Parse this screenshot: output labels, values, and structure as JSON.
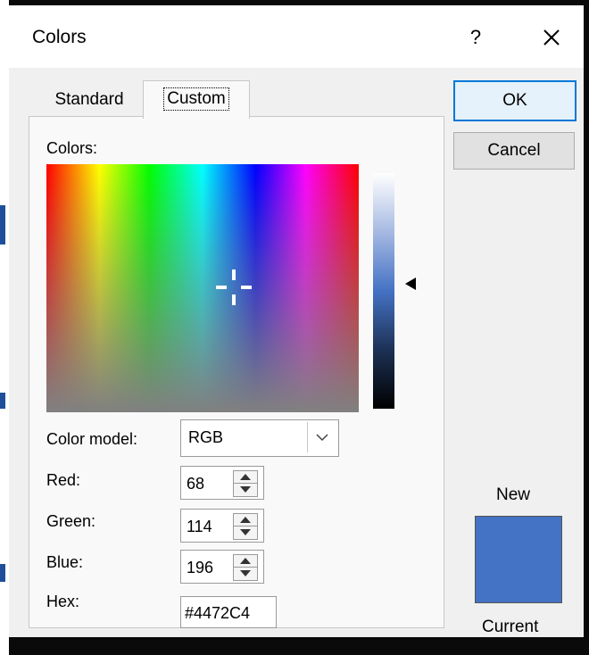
{
  "dialog": {
    "title": "Colors",
    "help_label": "?",
    "ok_label": "OK",
    "cancel_label": "Cancel"
  },
  "tabs": [
    {
      "label": "Standard",
      "selected": false
    },
    {
      "label": "Custom",
      "selected": true
    }
  ],
  "custom": {
    "colors_label": "Colors:",
    "color_model_label": "Color model:",
    "color_model_value": "RGB",
    "red_label": "Red:",
    "red_value": "68",
    "green_label": "Green:",
    "green_value": "114",
    "blue_label": "Blue:",
    "blue_value": "196",
    "hex_label": "Hex:",
    "hex_value": "#4472C4"
  },
  "preview": {
    "new_label": "New",
    "current_label": "Current",
    "color": "#4472C4"
  },
  "colors": {
    "selection_accent": "#0078d7",
    "current_color": "#4472C4"
  },
  "icons": [
    "close-icon",
    "chevron-down-icon",
    "spin-up-icon",
    "spin-down-icon",
    "crosshair-icon",
    "luminance-arrow-icon"
  ]
}
